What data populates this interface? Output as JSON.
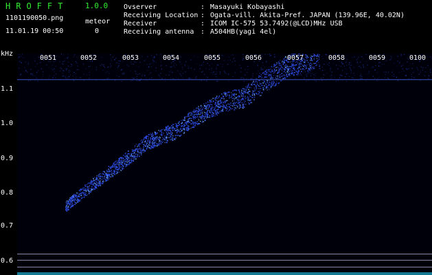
{
  "header": {
    "app_title": "HROFFT",
    "app_version": "1.0.0",
    "file_name": "1101190050.png",
    "date_time": "11.01.19 00:50",
    "meteor_label": "meteor",
    "meteor_count": "0"
  },
  "station_info": [
    {
      "label": "Ovserver",
      "value": "Masayuki Kobayashi"
    },
    {
      "label": "Receiving Location",
      "value": "Ogata-vill. Akita-Pref. JAPAN (139.96E, 40.02N)"
    },
    {
      "label": "Receiver",
      "value": "ICOM IC-575 53.7492(@LCD)MHz USB"
    },
    {
      "label": "Receiving antenna",
      "value": "A504HB(yagi 4el)"
    }
  ],
  "chart_data": {
    "type": "heatmap",
    "y_unit": "kHz",
    "y_ticks": [
      "1.1",
      "1.0",
      "0.9",
      "0.8",
      "0.7",
      "0.6"
    ],
    "x_ticks": [
      "0051",
      "0052",
      "0053",
      "0054",
      "0055",
      "0056",
      "0057",
      "0058",
      "0059",
      "0100"
    ],
    "colors": {
      "background": "#00000a",
      "signal": "#3355ff",
      "peak": "#88ccff"
    }
  }
}
